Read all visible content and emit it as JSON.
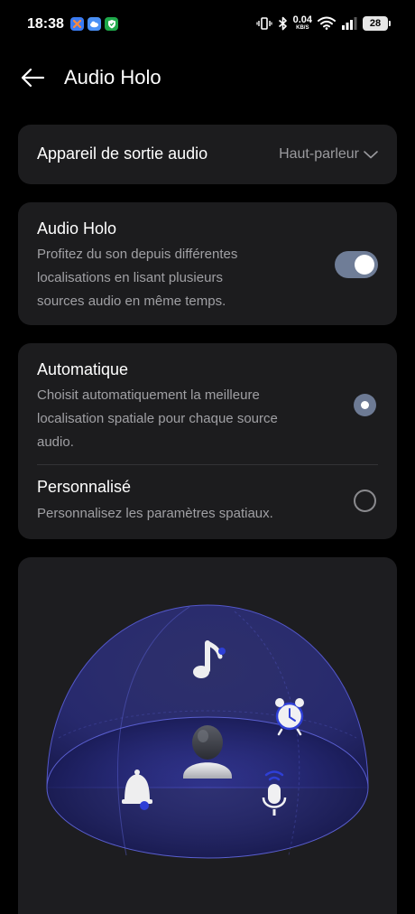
{
  "status": {
    "time": "18:38",
    "net_speed": "0.04",
    "net_unit": "KB/S",
    "battery": "28"
  },
  "header": {
    "title": "Audio Holo"
  },
  "output_device": {
    "label": "Appareil de sortie audio",
    "value": "Haut-parleur"
  },
  "audio_holo": {
    "title": "Audio Holo",
    "description_lines": [
      "Profitez du son depuis différentes",
      "localisations en lisant plusieurs",
      "sources audio en même temps."
    ],
    "enabled": true
  },
  "modes": [
    {
      "title": "Automatique",
      "description_lines": [
        "Choisit automatiquement la meilleure",
        "localisation spatiale pour chaque source",
        "audio."
      ],
      "selected": true
    },
    {
      "title": "Personnalisé",
      "description_lines": [
        "Personnalisez les paramètres spatiaux."
      ],
      "selected": false
    }
  ],
  "colors": {
    "background": "#000000",
    "card": "#1c1c1e",
    "accent": "#6f7d97",
    "dome": "#2a2d7a",
    "icon_blue": "#2e3fd6"
  }
}
